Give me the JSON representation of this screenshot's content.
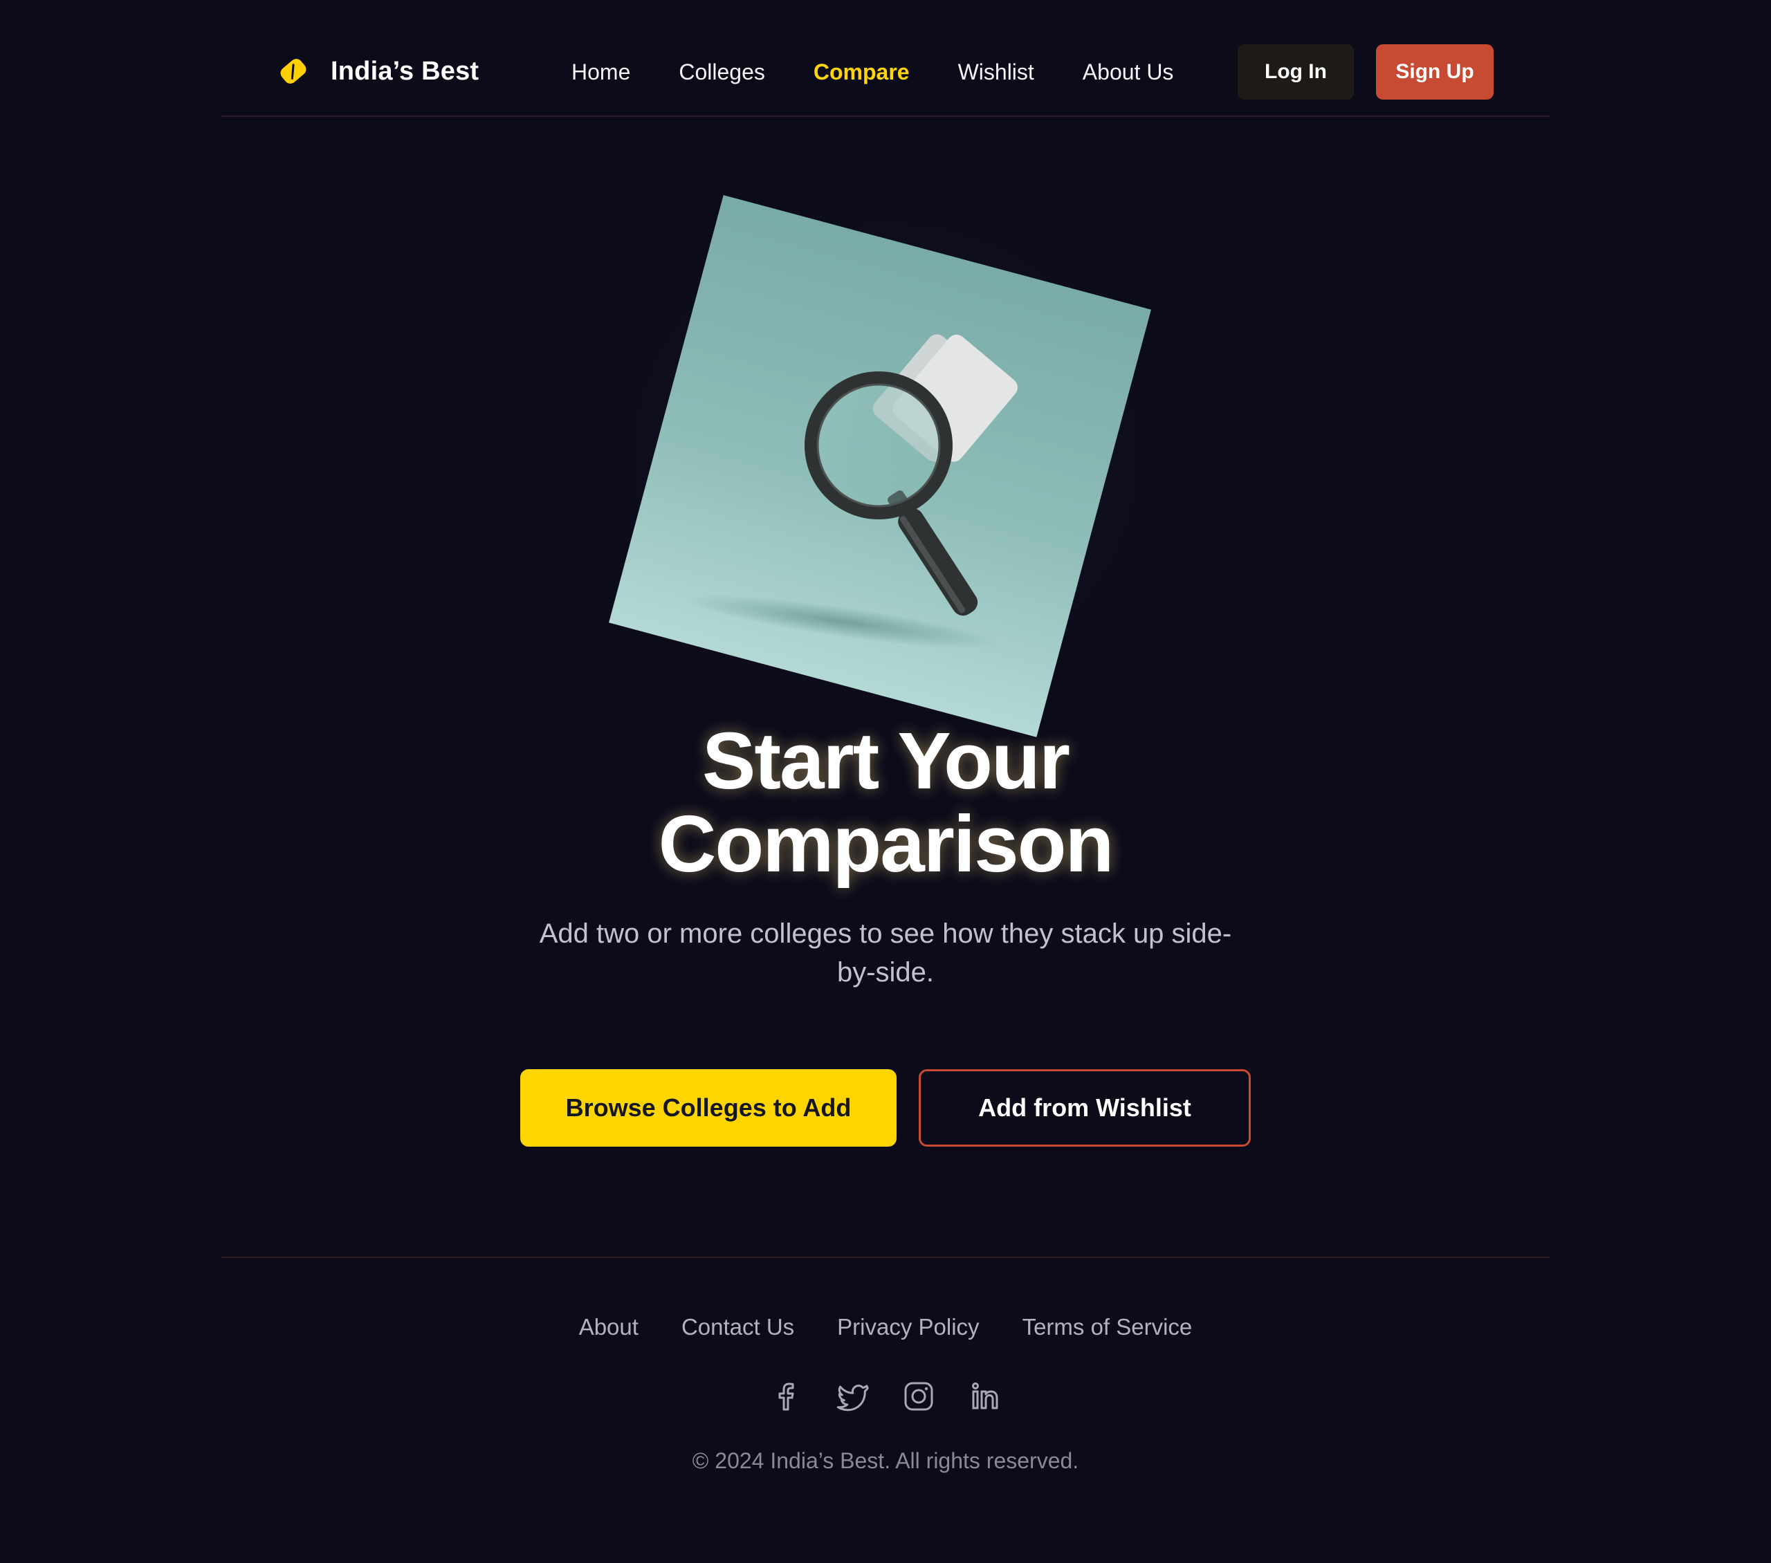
{
  "brand": {
    "name": "India’s Best",
    "logo_icon": "tag-icon",
    "accent_color": "#ffd500",
    "secondary_color": "#c84a32"
  },
  "nav": {
    "items": [
      {
        "label": "Home",
        "active": false
      },
      {
        "label": "Colleges",
        "active": false
      },
      {
        "label": "Compare",
        "active": true
      },
      {
        "label": "Wishlist",
        "active": false
      },
      {
        "label": "About Us",
        "active": false
      }
    ],
    "login_label": "Log In",
    "signup_label": "Sign Up"
  },
  "hero": {
    "image_icon": "magnifying-glass-illustration",
    "title_line1": "Start Your",
    "title_line2": "Comparison",
    "subtitle": "Add two or more colleges to see how they stack up side-by-side.",
    "primary_button": "Browse Colleges to Add",
    "secondary_button": "Add from Wishlist"
  },
  "footer": {
    "links": [
      "About",
      "Contact Us",
      "Privacy Policy",
      "Terms of Service"
    ],
    "social_icons": [
      "facebook-icon",
      "twitter-icon",
      "instagram-icon",
      "linkedin-icon"
    ],
    "copyright": "© 2024 India’s Best. All rights reserved."
  }
}
